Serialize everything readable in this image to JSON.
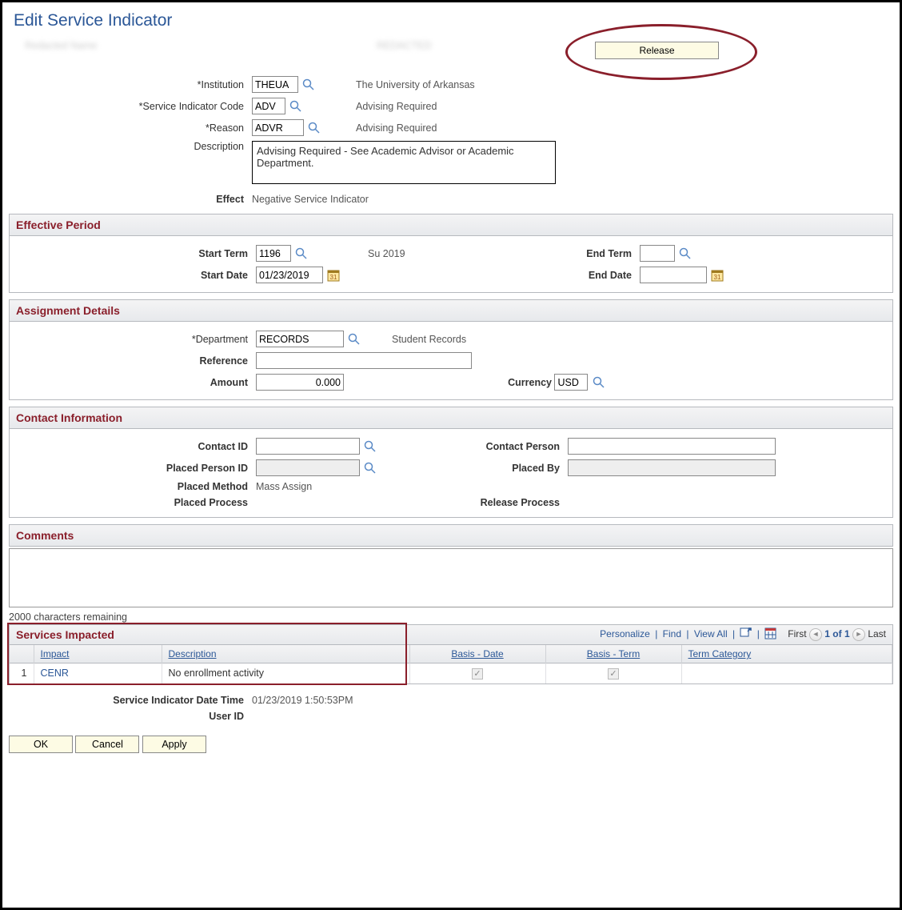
{
  "page": {
    "title": "Edit Service Indicator"
  },
  "header": {
    "name_redacted": "Redacted Name",
    "id_redacted": "REDACTED",
    "release_label": "Release"
  },
  "main": {
    "labels": {
      "institution": "Institution",
      "sic": "Service Indicator Code",
      "reason": "Reason",
      "description": "Description",
      "effect": "Effect"
    },
    "institution": {
      "value": "THEUA",
      "desc": "The University of Arkansas"
    },
    "sic": {
      "value": "ADV",
      "desc": "Advising Required"
    },
    "reason": {
      "value": "ADVR",
      "desc": "Advising Required"
    },
    "description": "Advising Required - See Academic Advisor or Academic Department.",
    "effect": "Negative Service Indicator"
  },
  "effective_period": {
    "title": "Effective Period",
    "labels": {
      "start_term": "Start Term",
      "end_term": "End Term",
      "start_date": "Start Date",
      "end_date": "End Date"
    },
    "start_term": {
      "value": "1196",
      "desc": "Su 2019"
    },
    "end_term": {
      "value": ""
    },
    "start_date": "01/23/2019",
    "end_date": ""
  },
  "assignment": {
    "title": "Assignment Details",
    "labels": {
      "department": "Department",
      "reference": "Reference",
      "amount": "Amount",
      "currency": "Currency"
    },
    "department": {
      "value": "RECORDS",
      "desc": "Student Records"
    },
    "reference": "",
    "amount": "0.000",
    "currency": "USD"
  },
  "contact": {
    "title": "Contact Information",
    "labels": {
      "contact_id": "Contact ID",
      "contact_person": "Contact Person",
      "placed_person_id": "Placed Person ID",
      "placed_by": "Placed By",
      "placed_method": "Placed Method",
      "placed_process": "Placed Process",
      "release_process": "Release Process"
    },
    "contact_id": "",
    "contact_person": "",
    "placed_person_id_redacted": "",
    "placed_by_redacted": "",
    "placed_method": "Mass Assign",
    "placed_process": "",
    "release_process": ""
  },
  "comments": {
    "title": "Comments",
    "value": "",
    "char_remaining": "2000 characters remaining"
  },
  "services_impacted": {
    "title": "Services Impacted",
    "toolbar": {
      "personalize": "Personalize",
      "find": "Find",
      "view_all": "View All",
      "first": "First",
      "last": "Last",
      "range": "1 of 1"
    },
    "columns": {
      "impact": "Impact",
      "description": "Description",
      "basis_date": "Basis - Date",
      "basis_term": "Basis - Term",
      "term_category": "Term Category"
    },
    "rows": [
      {
        "idx": "1",
        "impact": "CENR",
        "description": "No enrollment activity",
        "basis_date_checked": true,
        "basis_term_checked": true,
        "term_category": ""
      }
    ]
  },
  "footer": {
    "labels": {
      "si_datetime": "Service Indicator Date Time",
      "user_id": "User ID"
    },
    "si_datetime": "01/23/2019  1:50:53PM",
    "user_id_redacted": "",
    "user_name_redacted": ""
  },
  "buttons": {
    "ok": "OK",
    "cancel": "Cancel",
    "apply": "Apply"
  }
}
